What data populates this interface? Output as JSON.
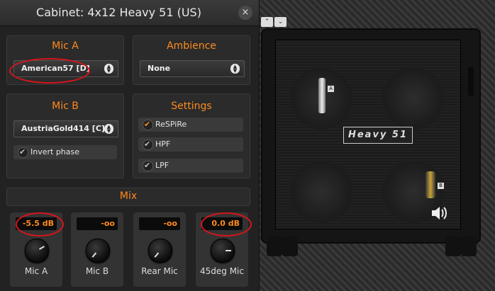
{
  "window": {
    "title": "Cabinet: 4x12 Heavy 51 (US)",
    "close_label": "×"
  },
  "mic_a": {
    "heading": "Mic A",
    "selected": "American57 [D]"
  },
  "ambience": {
    "heading": "Ambience",
    "selected": "None"
  },
  "mic_b": {
    "heading": "Mic B",
    "selected": "AustriaGold414 [C]",
    "invert_phase_label": "Invert phase",
    "invert_phase_checked": false
  },
  "settings": {
    "heading": "Settings",
    "options": [
      {
        "label": "ReSPiRe",
        "checked": true
      },
      {
        "label": "HPF",
        "checked": false
      },
      {
        "label": "LPF",
        "checked": false
      }
    ]
  },
  "mix": {
    "heading": "Mix",
    "channels": [
      {
        "label": "Mic A",
        "value": "-5.5 dB"
      },
      {
        "label": "Mic B",
        "value": "-oo"
      },
      {
        "label": "Rear Mic",
        "value": "-oo"
      },
      {
        "label": "45deg Mic",
        "value": "0.0 dB"
      }
    ]
  },
  "cabinet": {
    "logo_text": "Heavy 51",
    "mic_a_badge": "A",
    "mic_b_badge": "B",
    "nav_up": "⌃",
    "nav_down": "⌄"
  },
  "colors": {
    "accent": "#ff8a1e",
    "annotation": "#d8141c"
  }
}
